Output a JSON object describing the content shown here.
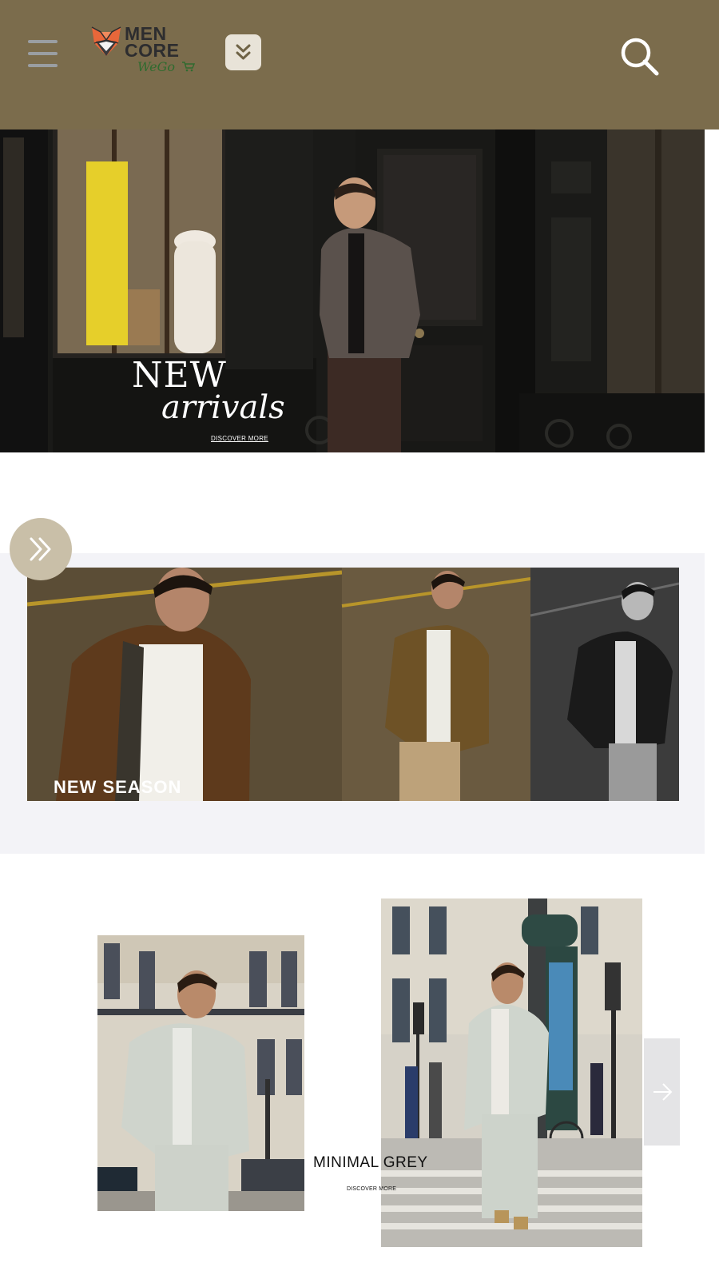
{
  "header": {
    "menu_icon": "hamburger-menu-icon",
    "logo": {
      "line1": "MEN",
      "line2": "CORE",
      "tagline": "WeGo",
      "icon": "fox-shield-logo-icon",
      "cart_icon": "cart-icon"
    },
    "dropdown_icon": "double-chevron-down-icon",
    "search_icon": "search-icon",
    "background_color": "#7b6c4c"
  },
  "hero": {
    "title": "NEW",
    "subtitle": "arrivals",
    "link": "DISCOVER MORE"
  },
  "season": {
    "nav_icon": "double-chevron-right-icon",
    "label": "NEW SEASON"
  },
  "collection": {
    "title": "MINIMAL GREY",
    "link": "DISCOVER MORE",
    "next_icon": "arrow-right-icon"
  }
}
